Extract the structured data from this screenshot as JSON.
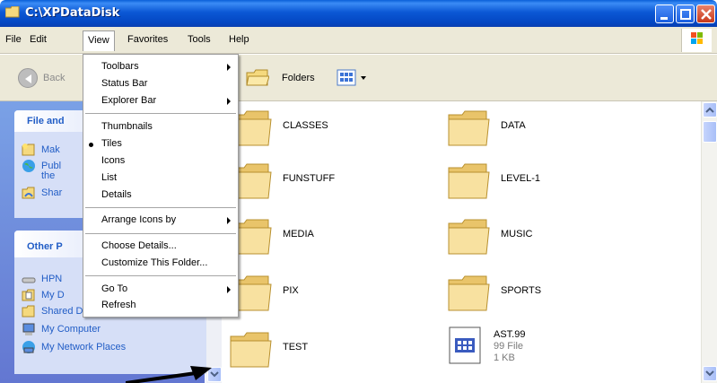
{
  "window": {
    "title": "C:\\XPDataDisk"
  },
  "menubar": {
    "items": [
      "File",
      "Edit",
      "View",
      "Favorites",
      "Tools",
      "Help"
    ],
    "active": "View"
  },
  "toolbar": {
    "back_label": "Back",
    "folders_label": "Folders"
  },
  "taskpane": {
    "file_tasks_title": "File and",
    "file_links": [
      "Mak",
      "Publ",
      "the",
      "Shar"
    ],
    "other_title": "Other P",
    "other_links": [
      "HPN",
      "My D",
      "Shared Documents",
      "My Computer",
      "My Network Places"
    ]
  },
  "view_menu": {
    "toolbars": "Toolbars",
    "status_bar": "Status Bar",
    "explorer_bar": "Explorer Bar",
    "thumbnails": "Thumbnails",
    "tiles": "Tiles",
    "icons": "Icons",
    "list": "List",
    "details": "Details",
    "arrange_icons": "Arrange Icons by",
    "choose_details": "Choose Details...",
    "customize_folder": "Customize This Folder...",
    "go_to": "Go To",
    "refresh": "Refresh",
    "selected_view": "Tiles"
  },
  "files": [
    {
      "name": "CLASSES",
      "type": "folder"
    },
    {
      "name": "DATA",
      "type": "folder"
    },
    {
      "name": "FUNSTUFF",
      "type": "folder"
    },
    {
      "name": "LEVEL-1",
      "type": "folder"
    },
    {
      "name": "MEDIA",
      "type": "folder"
    },
    {
      "name": "MUSIC",
      "type": "folder"
    },
    {
      "name": "PIX",
      "type": "folder"
    },
    {
      "name": "SPORTS",
      "type": "folder"
    },
    {
      "name": "TEST",
      "type": "folder"
    },
    {
      "name": "AST.99",
      "type": "file",
      "kind": "99 File",
      "size": "1 KB"
    }
  ],
  "colors": {
    "title_bar": "#0346c2",
    "link": "#215dc6",
    "folder": "#f3d98b",
    "menu_bg": "#ece9d8"
  }
}
